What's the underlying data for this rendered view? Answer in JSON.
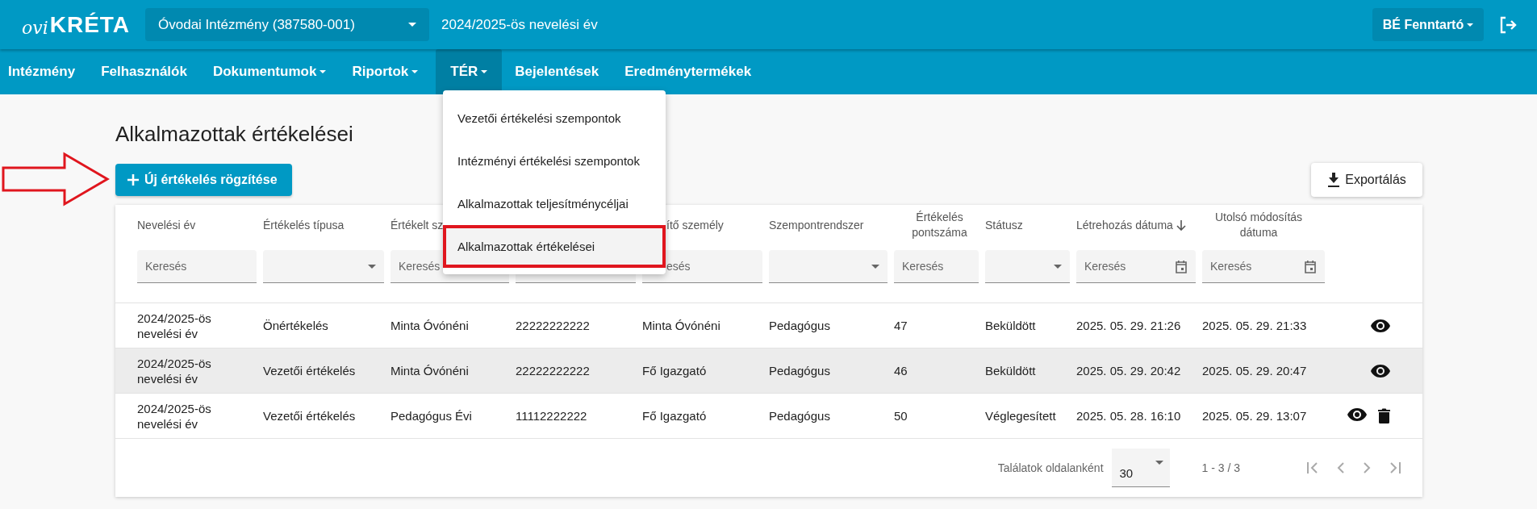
{
  "header": {
    "logo": {
      "prefix": "ovi",
      "name": "KRÉTA"
    },
    "institution": "Óvodai Intézmény (387580-001)",
    "school_year": "2024/2025-ös nevelési év",
    "user": "BÉ Fenntartó"
  },
  "nav": [
    {
      "label": "Intézmény",
      "dropdown": false,
      "selected": false
    },
    {
      "label": "Felhasználók",
      "dropdown": false,
      "selected": false
    },
    {
      "label": "Dokumentumok",
      "dropdown": true,
      "selected": false
    },
    {
      "label": "Riportok",
      "dropdown": true,
      "selected": false
    },
    {
      "label": "TÉR",
      "dropdown": true,
      "selected": true
    },
    {
      "label": "Bejelentések",
      "dropdown": false,
      "selected": false
    },
    {
      "label": "Eredménytermékek",
      "dropdown": false,
      "selected": false
    }
  ],
  "menu": [
    {
      "label": "Vezetői értékelési szempontok",
      "selected": false
    },
    {
      "label": "Intézményi értékelési szempontok",
      "selected": false
    },
    {
      "label": "Alkalmazottak teljesítménycéljai",
      "selected": false
    },
    {
      "label": "Alkalmazottak értékelései",
      "selected": true
    }
  ],
  "page": {
    "title": "Alkalmazottak értékelései",
    "new_button": "Új értékelés rögzítése",
    "export_button": "Exportálás"
  },
  "table": {
    "columns": [
      {
        "kind": "normal",
        "label": "Nevelési év",
        "filter": {
          "kind": "text",
          "placeholder": "Keresés"
        }
      },
      {
        "kind": "normal",
        "label": "Értékelés típusa",
        "filter": {
          "kind": "select"
        }
      },
      {
        "kind": "normal",
        "label": "Értékelt sz",
        "filter": {
          "kind": "text",
          "placeholder": "Keresés"
        }
      },
      {
        "kind": "covered",
        "filter": {
          "kind": "text"
        }
      },
      {
        "kind": "cut",
        "label": "ítő személy",
        "filter": {
          "kind": "text",
          "placeholder": "esés"
        }
      },
      {
        "kind": "normal",
        "label": "Szempontrendszer",
        "filter": {
          "kind": "select"
        }
      },
      {
        "kind": "normal",
        "label": "Értékelés pontszáma",
        "filter": {
          "kind": "text",
          "placeholder": "Keresés"
        }
      },
      {
        "kind": "normal",
        "label": "Státusz",
        "filter": {
          "kind": "select"
        }
      },
      {
        "kind": "sorted",
        "label": "Létrehozás dátuma",
        "filter": {
          "kind": "date",
          "placeholder": "Keresés"
        }
      },
      {
        "kind": "normal",
        "label": "Utolsó módosítás dátuma",
        "filter": {
          "kind": "date",
          "placeholder": "Keresés"
        }
      }
    ],
    "rows": [
      {
        "cells": [
          "2024/2025-ös nevelési év",
          "Önértékelés",
          "Minta Óvónéni",
          "22222222222",
          "Minta Óvónéni",
          "Pedagógus",
          "47",
          "Beküldött",
          "2025. 05. 29. 21:26",
          "2025. 05. 29. 21:33"
        ],
        "selected": false,
        "actions": [
          {
            "kind": "view"
          }
        ]
      },
      {
        "cells": [
          "2024/2025-ös nevelési év",
          "Vezetői értékelés",
          "Minta Óvónéni",
          "22222222222",
          "Fő Igazgató",
          "Pedagógus",
          "46",
          "Beküldött",
          "2025. 05. 29. 20:42",
          "2025. 05. 29. 20:47"
        ],
        "selected": true,
        "actions": [
          {
            "kind": "view"
          }
        ]
      },
      {
        "cells": [
          "2024/2025-ös nevelési év",
          "Vezetői értékelés",
          "Pedagógus Évi",
          "11112222222",
          "Fő Igazgató",
          "Pedagógus",
          "50",
          "Véglegesített",
          "2025. 05. 28. 16:10",
          "2025. 05. 29. 13:07"
        ],
        "selected": false,
        "actions": [
          {
            "kind": "view"
          },
          {
            "kind": "delete"
          }
        ]
      }
    ],
    "pagination": {
      "per_page_label": "Találatok oldalanként",
      "per_page": "30",
      "range": "1 - 3 / 3"
    }
  }
}
